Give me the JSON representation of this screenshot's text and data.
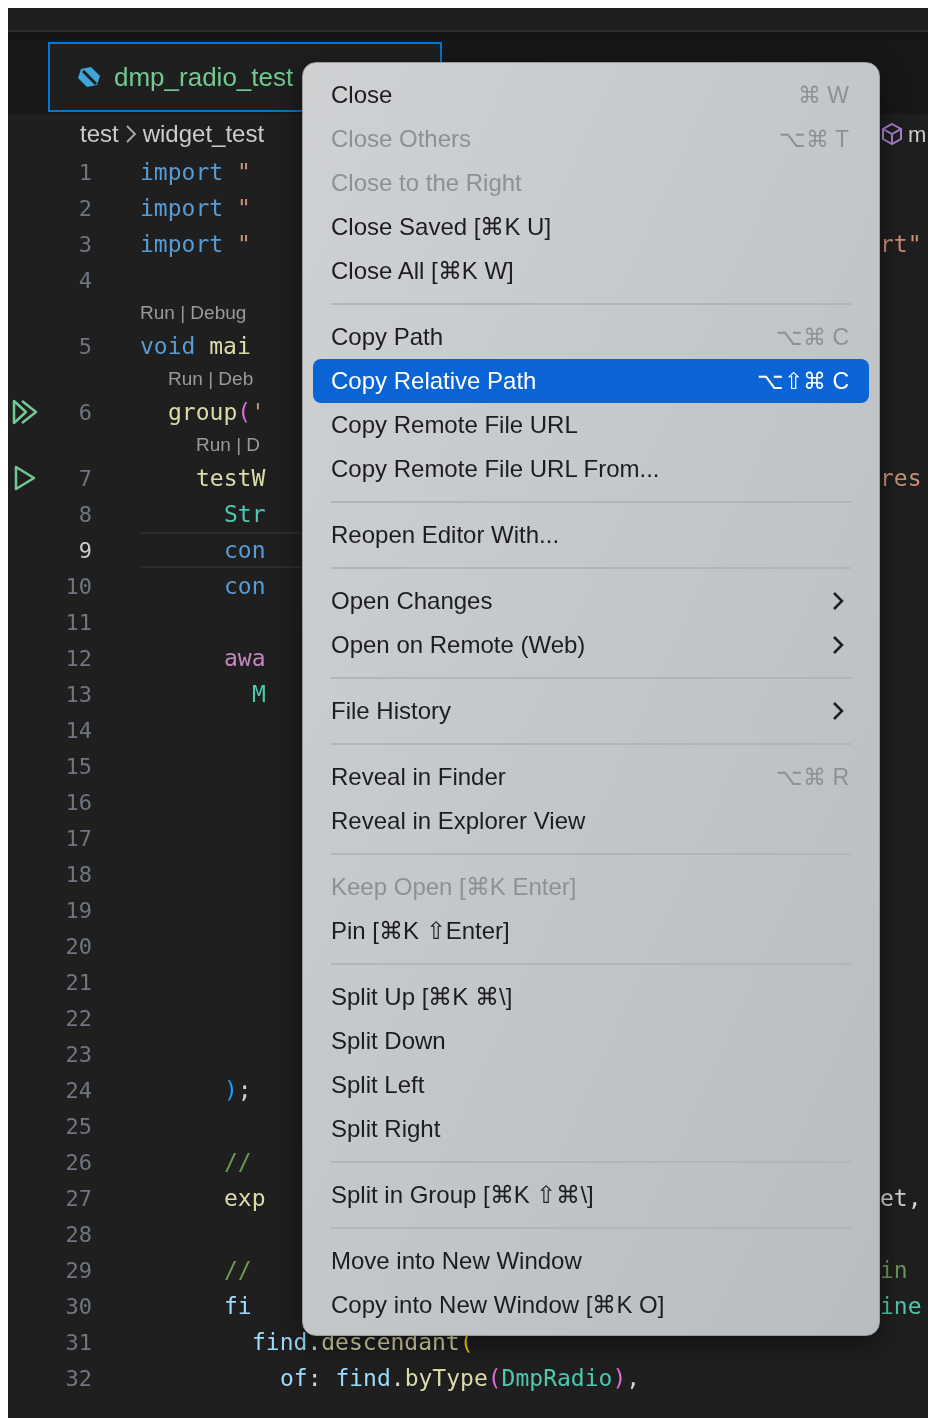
{
  "tab": {
    "label": "dmp_radio_test",
    "selected": true
  },
  "breadcrumbs": [
    "test",
    "widget_test"
  ],
  "breadcrumb_right": "m",
  "lines": [
    {
      "kind": "code",
      "number": "1",
      "tokens": [
        {
          "kind": "keyword",
          "text": "import"
        },
        {
          "kind": "string",
          "text": " \""
        }
      ]
    },
    {
      "kind": "code",
      "number": "2",
      "tokens": [
        {
          "kind": "keyword",
          "text": "import"
        },
        {
          "kind": "string",
          "text": " \""
        }
      ]
    },
    {
      "kind": "code",
      "number": "3",
      "tokens": [
        {
          "kind": "keyword",
          "text": "import"
        },
        {
          "kind": "string",
          "text": " \""
        }
      ],
      "right": {
        "kind": "string",
        "text": "rt\""
      }
    },
    {
      "kind": "code",
      "number": "4"
    },
    {
      "kind": "lens",
      "text": "Run | Debug"
    },
    {
      "kind": "code",
      "number": "5",
      "tokens": [
        {
          "kind": "keyword",
          "text": "void"
        },
        {
          "kind": "function",
          "text": " mai"
        }
      ],
      "children": [
        {
          "kind": "lens",
          "text": "Run | Deb"
        },
        {
          "kind": "code",
          "number": "6",
          "gutter": {
            "kind": "run-all"
          },
          "tokens": [
            {
              "kind": "function",
              "text": "group"
            },
            {
              "kind": "bracket2",
              "text": "("
            },
            {
              "kind": "string",
              "text": "'"
            }
          ],
          "children": [
            {
              "kind": "lens",
              "text": "Run | D"
            },
            {
              "kind": "code",
              "number": "7",
              "gutter": {
                "kind": "run"
              },
              "tokens": [
                {
                  "kind": "function",
                  "text": "testW"
                }
              ],
              "right": {
                "kind": "string",
                "text": "res"
              },
              "children": [
                {
                  "kind": "code",
                  "number": "8",
                  "tokens": [
                    {
                      "kind": "type",
                      "text": "Str"
                    }
                  ]
                },
                {
                  "kind": "code",
                  "number": "9",
                  "current": true,
                  "tokens": [
                    {
                      "kind": "keyword",
                      "text": "con"
                    }
                  ]
                },
                {
                  "kind": "code",
                  "number": "10",
                  "tokens": [
                    {
                      "kind": "keyword",
                      "text": "con"
                    }
                  ]
                },
                {
                  "kind": "code",
                  "number": "11"
                },
                {
                  "kind": "code",
                  "number": "12",
                  "tokens": [
                    {
                      "kind": "control",
                      "text": "awa"
                    }
                  ],
                  "children": [
                    {
                      "kind": "code",
                      "number": "13",
                      "tokens": [
                        {
                          "kind": "type",
                          "text": "M"
                        }
                      ]
                    },
                    {
                      "kind": "code",
                      "number": "14"
                    },
                    {
                      "kind": "code",
                      "number": "15"
                    },
                    {
                      "kind": "code",
                      "number": "16"
                    },
                    {
                      "kind": "code",
                      "number": "17"
                    },
                    {
                      "kind": "code",
                      "number": "18"
                    },
                    {
                      "kind": "code",
                      "number": "19"
                    },
                    {
                      "kind": "code",
                      "number": "20"
                    },
                    {
                      "kind": "code",
                      "number": "21"
                    },
                    {
                      "kind": "code",
                      "number": "22"
                    },
                    {
                      "kind": "code",
                      "number": "23"
                    }
                  ]
                },
                {
                  "kind": "code",
                  "number": "24",
                  "tokens": [
                    {
                      "kind": "bracket3",
                      "text": ")"
                    },
                    {
                      "kind": "plain",
                      "text": ";"
                    }
                  ]
                },
                {
                  "kind": "code",
                  "number": "25"
                },
                {
                  "kind": "code",
                  "number": "26",
                  "tokens": [
                    {
                      "kind": "comment",
                      "text": "//"
                    }
                  ]
                },
                {
                  "kind": "code",
                  "number": "27",
                  "tokens": [
                    {
                      "kind": "function",
                      "text": "exp"
                    }
                  ],
                  "right": {
                    "kind": "plain",
                    "text": "et,"
                  }
                },
                {
                  "kind": "code",
                  "number": "28"
                },
                {
                  "kind": "code",
                  "number": "29",
                  "tokens": [
                    {
                      "kind": "comment",
                      "text": "//"
                    }
                  ],
                  "right": {
                    "kind": "comment",
                    "text": "in"
                  }
                },
                {
                  "kind": "code",
                  "number": "30",
                  "tokens": [
                    {
                      "kind": "variable",
                      "text": "fi"
                    }
                  ],
                  "right": {
                    "kind": "type",
                    "text": "ine"
                  },
                  "children": [
                    {
                      "kind": "code",
                      "number": "31",
                      "tokens": [
                        {
                          "kind": "variable",
                          "text": "find"
                        },
                        {
                          "kind": "plain",
                          "text": "."
                        },
                        {
                          "kind": "function",
                          "text": "descendant"
                        },
                        {
                          "kind": "bracket1",
                          "text": "("
                        }
                      ],
                      "children": [
                        {
                          "kind": "code",
                          "number": "32",
                          "tokens": [
                            {
                              "kind": "variable",
                              "text": "of"
                            },
                            {
                              "kind": "plain",
                              "text": ": "
                            },
                            {
                              "kind": "variable",
                              "text": "find"
                            },
                            {
                              "kind": "plain",
                              "text": "."
                            },
                            {
                              "kind": "function",
                              "text": "byType"
                            },
                            {
                              "kind": "bracket2",
                              "text": "("
                            },
                            {
                              "kind": "type",
                              "text": "DmpRadio"
                            },
                            {
                              "kind": "bracket2",
                              "text": ")"
                            },
                            {
                              "kind": "plain",
                              "text": ","
                            }
                          ]
                        }
                      ]
                    }
                  ]
                }
              ]
            }
          ]
        }
      ]
    }
  ],
  "menu": [
    {
      "kind": "item",
      "label": "Close",
      "shortcut": "⌘ W",
      "disabled": false,
      "selected": false,
      "submenu": false
    },
    {
      "kind": "item",
      "label": "Close Others",
      "shortcut": "⌥⌘ T",
      "disabled": true,
      "selected": false,
      "submenu": false
    },
    {
      "kind": "item",
      "label": "Close to the Right",
      "disabled": true,
      "selected": false,
      "submenu": false
    },
    {
      "kind": "item",
      "label": "Close Saved [⌘K U]",
      "disabled": false,
      "selected": false,
      "submenu": false
    },
    {
      "kind": "item",
      "label": "Close All [⌘K W]",
      "disabled": false,
      "selected": false,
      "submenu": false
    },
    {
      "kind": "separator"
    },
    {
      "kind": "item",
      "label": "Copy Path",
      "shortcut": "⌥⌘ C",
      "disabled": false,
      "selected": false,
      "submenu": false
    },
    {
      "kind": "item",
      "label": "Copy Relative Path",
      "shortcut": "⌥⇧⌘ C",
      "disabled": false,
      "selected": true,
      "submenu": false
    },
    {
      "kind": "item",
      "label": "Copy Remote File URL",
      "disabled": false,
      "selected": false,
      "submenu": false
    },
    {
      "kind": "item",
      "label": "Copy Remote File URL From...",
      "disabled": false,
      "selected": false,
      "submenu": false
    },
    {
      "kind": "separator"
    },
    {
      "kind": "item",
      "label": "Reopen Editor With...",
      "disabled": false,
      "selected": false,
      "submenu": false
    },
    {
      "kind": "separator"
    },
    {
      "kind": "item",
      "label": "Open Changes",
      "disabled": false,
      "selected": false,
      "submenu": true
    },
    {
      "kind": "item",
      "label": "Open on Remote (Web)",
      "disabled": false,
      "selected": false,
      "submenu": true
    },
    {
      "kind": "separator"
    },
    {
      "kind": "item",
      "label": "File History",
      "disabled": false,
      "selected": false,
      "submenu": true
    },
    {
      "kind": "separator"
    },
    {
      "kind": "item",
      "label": "Reveal in Finder",
      "shortcut": "⌥⌘ R",
      "disabled": false,
      "selected": false,
      "submenu": false
    },
    {
      "kind": "item",
      "label": "Reveal in Explorer View",
      "disabled": false,
      "selected": false,
      "submenu": false
    },
    {
      "kind": "separator"
    },
    {
      "kind": "item",
      "label": "Keep Open [⌘K Enter]",
      "disabled": true,
      "selected": false,
      "submenu": false
    },
    {
      "kind": "item",
      "label": "Pin [⌘K ⇧Enter]",
      "disabled": false,
      "selected": false,
      "submenu": false
    },
    {
      "kind": "separator"
    },
    {
      "kind": "item",
      "label": "Split Up [⌘K ⌘\\]",
      "disabled": false,
      "selected": false,
      "submenu": false
    },
    {
      "kind": "item",
      "label": "Split Down",
      "disabled": false,
      "selected": false,
      "submenu": false
    },
    {
      "kind": "item",
      "label": "Split Left",
      "disabled": false,
      "selected": false,
      "submenu": false
    },
    {
      "kind": "item",
      "label": "Split Right",
      "disabled": false,
      "selected": false,
      "submenu": false
    },
    {
      "kind": "separator"
    },
    {
      "kind": "item",
      "label": "Split in Group [⌘K ⇧⌘\\]",
      "disabled": false,
      "selected": false,
      "submenu": false
    },
    {
      "kind": "separator"
    },
    {
      "kind": "item",
      "label": "Move into New Window",
      "disabled": false,
      "selected": false,
      "submenu": false
    },
    {
      "kind": "item",
      "label": "Copy into New Window [⌘K O]",
      "disabled": false,
      "selected": false,
      "submenu": false
    }
  ]
}
